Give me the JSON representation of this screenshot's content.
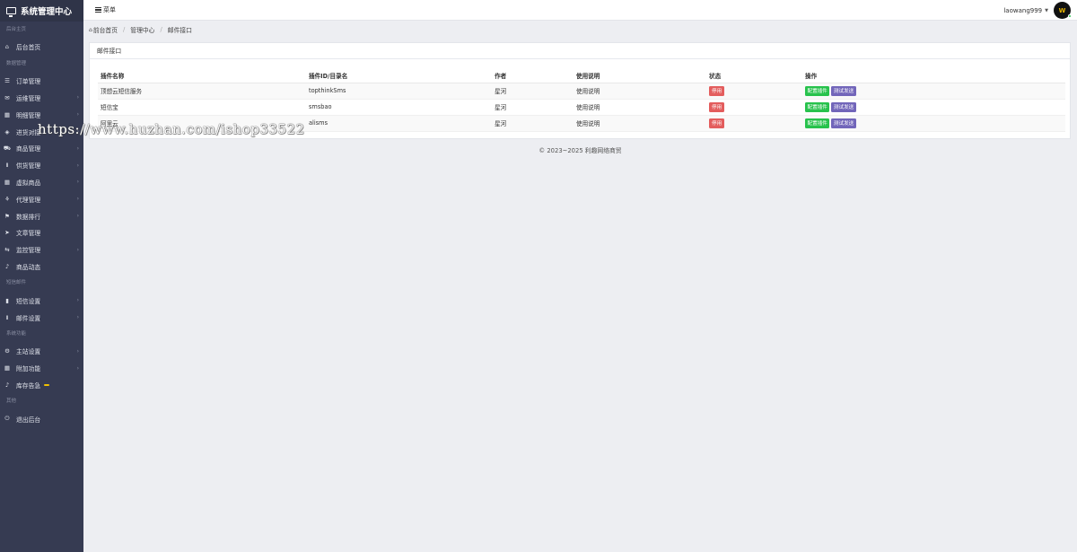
{
  "brand": {
    "title": "系统管理中心",
    "icon": "monitor-icon"
  },
  "topbar": {
    "menu_label": "菜单",
    "username": "laowang999",
    "avatar_text": "W"
  },
  "sidebar": {
    "sections": [
      {
        "label": "后台主页",
        "items": [
          {
            "label": "后台首页",
            "icon": "home-icon",
            "has_children": false
          }
        ]
      },
      {
        "label": "数据管理",
        "items": [
          {
            "label": "订单管理",
            "icon": "list-icon",
            "has_children": false
          },
          {
            "label": "运维管理",
            "icon": "comments-icon",
            "has_children": true
          },
          {
            "label": "明细管理",
            "icon": "calendar-icon",
            "has_children": true
          },
          {
            "label": "进货对接",
            "icon": "cubes-icon",
            "has_children": true
          },
          {
            "label": "商品管理",
            "icon": "cart-icon",
            "has_children": true
          },
          {
            "label": "供货管理",
            "icon": "cutlery-icon",
            "has_children": true
          },
          {
            "label": "虚拟商品",
            "icon": "th-icon",
            "has_children": true
          },
          {
            "label": "代理管理",
            "icon": "sitemap-icon",
            "has_children": true
          },
          {
            "label": "数据排行",
            "icon": "flag-icon",
            "has_children": true
          },
          {
            "label": "文章管理",
            "icon": "send-icon",
            "has_children": false
          },
          {
            "label": "监控管理",
            "icon": "retweet-icon",
            "has_children": true
          },
          {
            "label": "商品动态",
            "icon": "bell-icon",
            "has_children": false
          }
        ]
      },
      {
        "label": "短信邮件",
        "items": [
          {
            "label": "短信设置",
            "icon": "bar-chart-icon",
            "has_children": true
          },
          {
            "label": "邮件设置",
            "icon": "cutlery-icon",
            "has_children": true
          }
        ]
      },
      {
        "label": "系统功能",
        "items": [
          {
            "label": "主站设置",
            "icon": "gear-icon",
            "has_children": true
          },
          {
            "label": "附加功能",
            "icon": "calendar-icon",
            "has_children": true
          },
          {
            "label": "库存告急",
            "icon": "bell-icon",
            "has_children": false,
            "badge": true
          }
        ]
      },
      {
        "label": "其他",
        "items": [
          {
            "label": "退出后台",
            "icon": "power-icon",
            "has_children": false
          }
        ]
      }
    ]
  },
  "breadcrumb": {
    "items": [
      "前台首页",
      "管理中心",
      "邮件接口"
    ]
  },
  "panel": {
    "title": "邮件接口",
    "columns": [
      "插件名称",
      "插件ID/目录名",
      "作者",
      "使用说明",
      "状态",
      "操作"
    ],
    "rows": [
      {
        "name": "顶想云短信服务",
        "id": "topthinkSms",
        "author": "星河",
        "doc": "使用说明",
        "status": "停用",
        "action_config": "配置插件",
        "action_test": "测试发送"
      },
      {
        "name": "短信宝",
        "id": "smsbao",
        "author": "星河",
        "doc": "使用说明",
        "status": "停用",
        "action_config": "配置插件",
        "action_test": "测试发送"
      },
      {
        "name": "阿里云",
        "id": "alisms",
        "author": "星河",
        "doc": "使用说明",
        "status": "停用",
        "action_config": "配置插件",
        "action_test": "测试发送"
      }
    ]
  },
  "footer": {
    "text": "© 2023~2025 利趣网络商贸"
  },
  "watermark": {
    "text": "https://www.huzhan.com/ishop33522"
  },
  "colors": {
    "sidebar_bg": "#363b52",
    "danger": "#e35d5d",
    "success": "#27c24c",
    "purple": "#7266ba",
    "warning": "#f0c100"
  }
}
